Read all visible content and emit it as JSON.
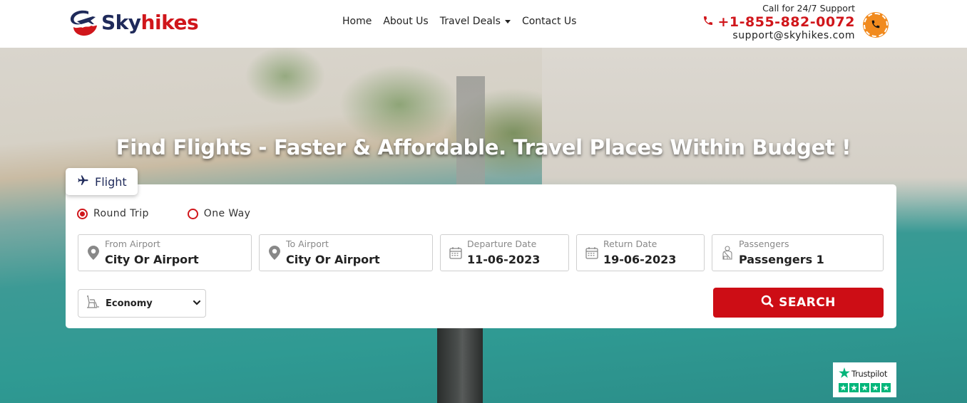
{
  "header": {
    "logo": {
      "part1": "Sky",
      "part2": "hikes"
    },
    "nav": [
      {
        "label": "Home"
      },
      {
        "label": "About Us"
      },
      {
        "label": "Travel Deals",
        "has_dropdown": true
      },
      {
        "label": "Contact Us"
      }
    ],
    "support": {
      "label": "Call for 24/7 Support",
      "phone": "+1-855-882-0072",
      "email": "support@skyhikes.com"
    }
  },
  "hero": {
    "title": "Find Flights - Faster & Affordable. Travel Places Within Budget !"
  },
  "search": {
    "tab_label": "Flight",
    "trip_types": [
      {
        "label": "Round Trip",
        "checked": true
      },
      {
        "label": "One Way",
        "checked": false
      }
    ],
    "fields": {
      "from": {
        "label": "From Airport",
        "value": "City Or Airport",
        "icon": "map-pin-icon"
      },
      "to": {
        "label": "To Airport",
        "value": "City Or Airport",
        "icon": "map-pin-icon"
      },
      "departure": {
        "label": "Departure Date",
        "value": "11-06-2023",
        "icon": "calendar-icon"
      },
      "return": {
        "label": "Return Date",
        "value": "19-06-2023",
        "icon": "calendar-icon"
      },
      "passengers": {
        "label": "Passengers",
        "value": "Passengers 1",
        "icon": "passenger-icon"
      }
    },
    "cabin_class": {
      "selected": "Economy",
      "icon": "seat-icon"
    },
    "search_label": "SEARCH"
  },
  "trustpilot": {
    "label": "Trustpilot",
    "stars": 5
  },
  "colors": {
    "brand_navy": "#1f2a5a",
    "brand_red": "#d0161b",
    "button_red": "#cd0d15",
    "phone_orange": "#f18a1e",
    "trustpilot_green": "#00b67a"
  }
}
